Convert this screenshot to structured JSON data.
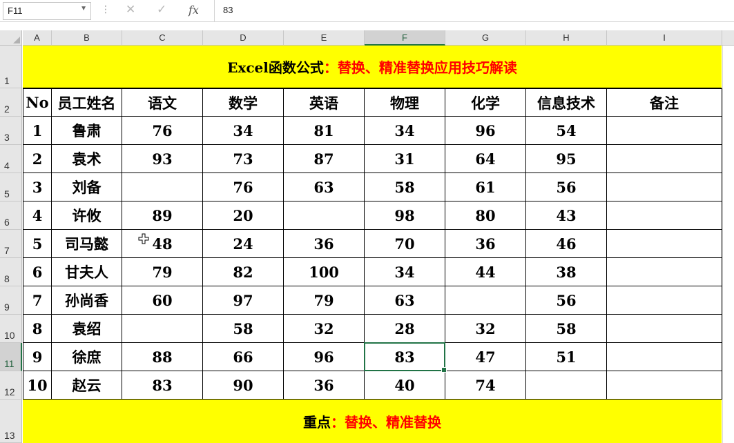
{
  "formula_bar": {
    "name_box": "F11",
    "formula_value": "83",
    "cancel_icon": "cancel-icon",
    "enter_icon": "enter-icon",
    "fx_label": "fx"
  },
  "columns": [
    "A",
    "B",
    "C",
    "D",
    "E",
    "F",
    "G",
    "H",
    "I"
  ],
  "selected_column": "F",
  "rows": [
    "1",
    "2",
    "3",
    "4",
    "5",
    "6",
    "7",
    "8",
    "9",
    "10",
    "11",
    "12",
    "13"
  ],
  "selected_row": "11",
  "title_banner": {
    "black": "Excel函数公式",
    "red": "：替换、精准替换应用技巧解读"
  },
  "footer_banner": {
    "black": "重点",
    "red": "：替换、精准替换"
  },
  "table": {
    "headers": [
      "No",
      "员工姓名",
      "语文",
      "数学",
      "英语",
      "物理",
      "化学",
      "信息技术",
      "备注"
    ],
    "rows": [
      [
        "1",
        "鲁肃",
        "76",
        "34",
        "81",
        "34",
        "96",
        "54",
        ""
      ],
      [
        "2",
        "袁术",
        "93",
        "73",
        "87",
        "31",
        "64",
        "95",
        ""
      ],
      [
        "3",
        "刘备",
        "",
        "76",
        "63",
        "58",
        "61",
        "56",
        ""
      ],
      [
        "4",
        "许攸",
        "89",
        "20",
        "",
        "98",
        "80",
        "43",
        ""
      ],
      [
        "5",
        "司马懿",
        "48",
        "24",
        "36",
        "70",
        "36",
        "46",
        ""
      ],
      [
        "6",
        "甘夫人",
        "79",
        "82",
        "100",
        "34",
        "44",
        "38",
        ""
      ],
      [
        "7",
        "孙尚香",
        "60",
        "97",
        "79",
        "63",
        "",
        "56",
        ""
      ],
      [
        "8",
        "袁绍",
        "",
        "58",
        "32",
        "28",
        "32",
        "58",
        ""
      ],
      [
        "9",
        "徐庶",
        "88",
        "66",
        "96",
        "83",
        "47",
        "51",
        ""
      ],
      [
        "10",
        "赵云",
        "83",
        "90",
        "36",
        "40",
        "74",
        "",
        ""
      ]
    ]
  },
  "colors": {
    "banner_bg": "#ffff00",
    "red_text": "#ff0000",
    "selection": "#217346"
  }
}
